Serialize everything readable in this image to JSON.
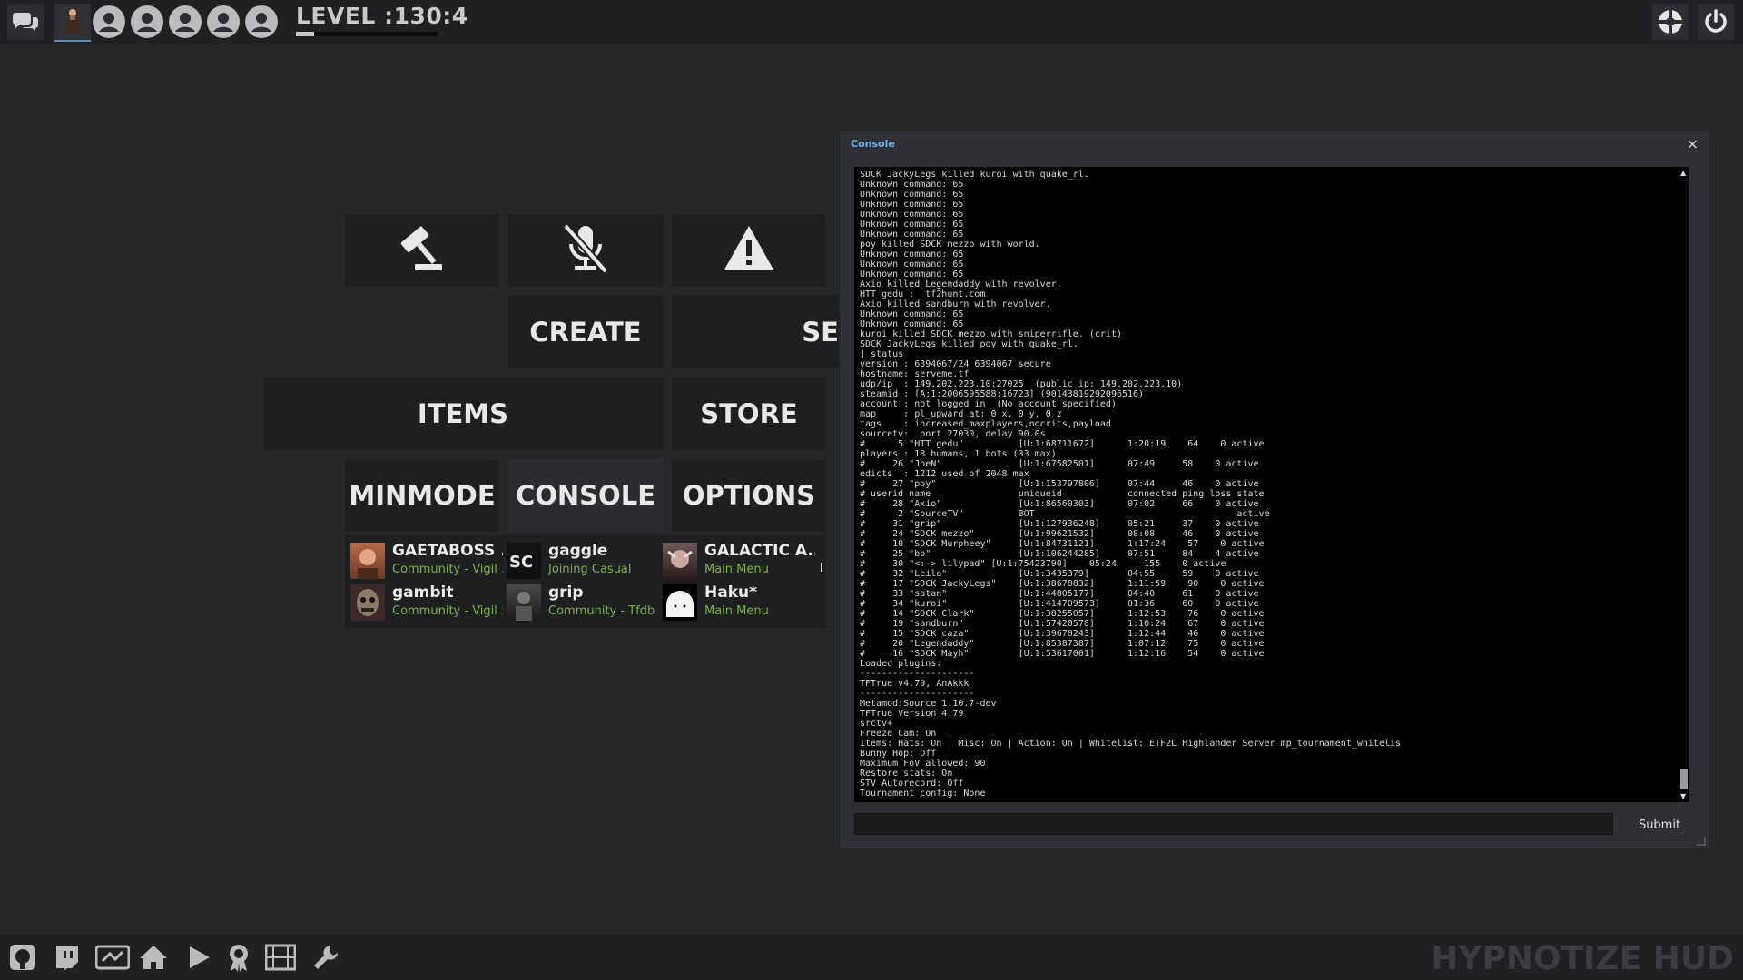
{
  "topbar": {
    "level_label": "LEVEL :130:4",
    "level_progress": 0.13,
    "icons": [
      "chat-icon",
      "character-icon",
      "avatar-icon",
      "avatar-icon",
      "avatar-icon",
      "avatar-icon",
      "avatar-icon",
      "tf2-logo-icon",
      "power-icon"
    ]
  },
  "menu": {
    "create": "CREATE",
    "server_partial": "SE",
    "items": "ITEMS",
    "store": "STORE",
    "minmode": "MINMODE",
    "console": "CONSOLE",
    "options": "OPTIONS",
    "icon_buttons": [
      "gavel-icon",
      "mic-muted-icon",
      "warning-icon"
    ]
  },
  "friends": [
    {
      "name": "GAETABOSS ...",
      "status": "Community - Vigil ..."
    },
    {
      "name": "gaggle",
      "status": "Joining Casual"
    },
    {
      "name": "GALACTIC A...",
      "status": "Main Menu"
    },
    {
      "name": "gambit",
      "status": "Community - Vigil ..."
    },
    {
      "name": "grip",
      "status": "Community - Tfdb ..."
    },
    {
      "name": "Haku*",
      "status": "Main Menu"
    }
  ],
  "console": {
    "title": "Console",
    "close": "×",
    "submit": "Submit",
    "output": "SDCK JackyLegs killed kuroi with quake_rl.\nUnknown command: 65\nUnknown command: 65\nUnknown command: 65\nUnknown command: 65\nUnknown command: 65\nUnknown command: 65\npoy killed SDCK mezzo with world.\nUnknown command: 65\nUnknown command: 65\nUnknown command: 65\nAxio killed Legendaddy with revolver.\nHTT gedu :  tf2hunt.com\nAxio killed sandburn with revolver.\nUnknown command: 65\nUnknown command: 65\nkuroi killed SDCK mezzo with sniperrifle. (crit)\nSDCK JackyLegs killed poy with quake_rl.\n] status\nversion : 6394067/24 6394067 secure\nhostname: serveme.tf\nudp/ip  : 149.202.223.10:27025  (public ip: 149.202.223.10)\nsteamid : [A:1:2006595588:16723] (90143819292096516)\naccount : not logged in  (No account specified)\nmap     : pl_upward at: 0 x, 0 y, 0 z\ntags    : increased_maxplayers,nocrits,payload\nsourcetv:  port 27030, delay 90.0s\n#      5 \"HTT gedu\"          [U:1:68711672]      1:20:19    64    0 active\nplayers : 18 humans, 1 bots (33 max)\n#     26 \"JoeN\"              [U:1:67582501]      07:49     58    0 active\nedicts  : 1212 used of 2048 max\n#     27 \"poy\"               [U:1:153797806]     07:44     46    0 active\n# userid name                uniqueid            connected ping loss state\n#     28 \"Axio\"              [U:1:86560303]      07:02     66    0 active\n#      2 \"SourceTV\"          BOT                                     active\n#     31 \"grip\"              [U:1:127936248]     05:21     37    0 active\n#     24 \"SDCK mezzo\"        [U:1:99621532]      08:08     46    0 active\n#     10 \"SDCK Murpheey\"     [U:1:84731121]      1:17:24    57    0 active\n#     25 \"bb\"                [U:1:106244285]     07:51     84    4 active\n#     30 \"<:-> lilypad\" [U:1:75423790]    05:24     155    0 active\n#     32 \"Leila\"             [U:1:3435379]       04:55     59    0 active\n#     17 \"SDCK JackyLegs\"    [U:1:38678832]      1:11:59    90    0 active\n#     33 \"satan\"             [U:1:44805177]      04:40     61    0 active\n#     34 \"kuroi\"             [U:1:414709573]     01:36     60    0 active\n#     14 \"SDCK Clark\"        [U:1:38255057]      1:12:53    76    0 active\n#     19 \"sandburn\"          [U:1:57420578]      1:10:24    67    0 active\n#     15 \"SDCK caza\"         [U:1:39670243]      1:12:44    46    0 active\n#     20 \"Legendaddy\"        [U:1:85387387]      1:07:12    75    0 active\n#     16 \"SDCK Mayh\"         [U:1:53617001]      1:12:16    54    0 active\nLoaded plugins:\n---------------------\nTFTrue v4.79, AnAkkk\n---------------------\nMetamod:Source 1.10.7-dev\nTFTrue Version 4.79\nsrctv+\nFreeze Cam: On\nItems: Hats: On | Misc: On | Action: On | Whitelist: ETF2L Highlander Server mp_tournament_whitelis\nBunny Hop: Off\nMaximum FoV allowed: 90\nRestore stats: On\nSTV Autorecord: Off\nTournament config: None"
  },
  "bottombar": {
    "brand": "HYPNOTIZE HUD",
    "icons": [
      "github-icon",
      "twitch-icon",
      "server-browser-icon",
      "home-icon",
      "play-icon",
      "achievements-icon",
      "replay-icon",
      "wrench-icon"
    ]
  }
}
